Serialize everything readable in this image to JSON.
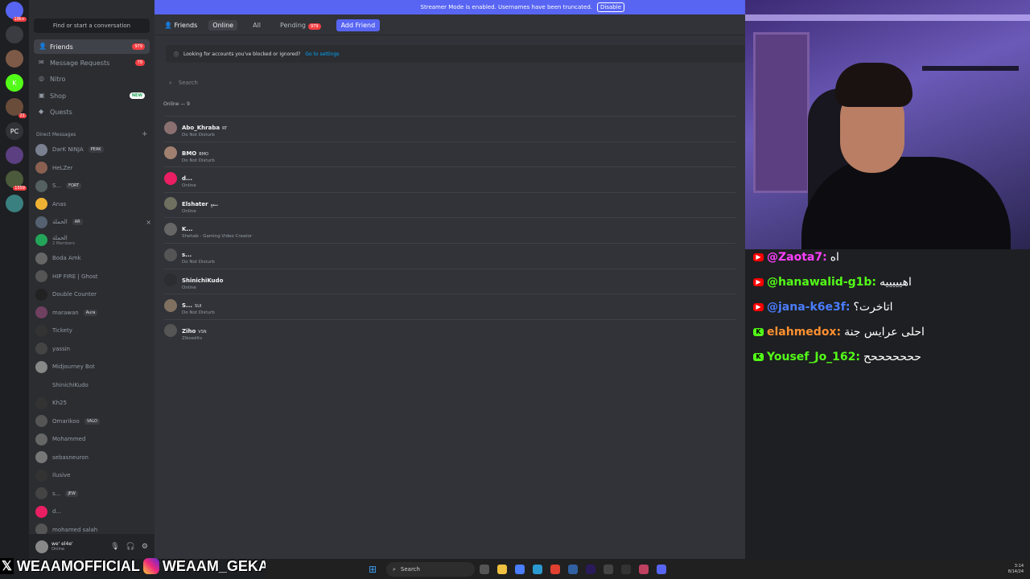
{
  "server_rail": [
    {
      "label": "",
      "badge": "18k+",
      "color": "#5865f2"
    },
    {
      "label": "",
      "badge": "",
      "color": "#3a3c42"
    },
    {
      "label": "",
      "badge": "",
      "color": "#7d5a47"
    },
    {
      "label": "K",
      "badge": "",
      "color": "#53fc18"
    },
    {
      "label": "",
      "badge": "21",
      "color": "#6a4c3b"
    },
    {
      "label": "PC",
      "badge": "",
      "color": "#313338"
    },
    {
      "label": "",
      "badge": "",
      "color": "#5b3f80"
    },
    {
      "label": "",
      "badge": "1559",
      "color": "#4a5a3a"
    },
    {
      "label": "",
      "badge": "",
      "color": "#3a8080"
    }
  ],
  "sidebar": {
    "search_placeholder": "Find or start a conversation",
    "nav": [
      {
        "label": "Friends",
        "count": "979",
        "icon": "friends-icon"
      },
      {
        "label": "Message Requests",
        "count": "79",
        "icon": "mail-icon"
      },
      {
        "label": "Nitro",
        "count": "",
        "icon": "nitro-icon"
      },
      {
        "label": "Shop",
        "count": "",
        "new": "NEW",
        "icon": "shop-icon"
      },
      {
        "label": "Quests",
        "count": "",
        "icon": "quests-icon"
      }
    ],
    "dm_header": "Direct Messages",
    "dms": [
      {
        "name": "DarK NINJA",
        "tag": "PEAK",
        "sub": "",
        "color": "#7a8090"
      },
      {
        "name": "HeLZer",
        "tag": "",
        "sub": "",
        "color": "#8a6050"
      },
      {
        "name": "S...",
        "tag": "FORT",
        "sub": "",
        "color": "#556060"
      },
      {
        "name": "Anas",
        "tag": "",
        "sub": "",
        "color": "#f0b232"
      },
      {
        "name": "الحملة",
        "tag": "AR",
        "sub": "",
        "color": "#556070"
      },
      {
        "name": "الحملة",
        "tag": "",
        "sub": "2 Members",
        "color": "#23a559"
      },
      {
        "name": "Boda Amk",
        "tag": "",
        "sub": "",
        "color": "#666"
      },
      {
        "name": "HIP FIRE | Ghost",
        "tag": "",
        "sub": "",
        "color": "#555"
      },
      {
        "name": "Double Counter",
        "tag": "",
        "sub": "",
        "color": "#222"
      },
      {
        "name": "marawan",
        "tag": "Aura",
        "sub": "",
        "color": "#704060"
      },
      {
        "name": "Tickety",
        "tag": "",
        "sub": "",
        "color": "#333"
      },
      {
        "name": "yassin",
        "tag": "",
        "sub": "",
        "color": "#444"
      },
      {
        "name": "Midjourney Bot",
        "tag": "",
        "sub": "",
        "color": "#888"
      },
      {
        "name": "ShinichiKudo",
        "tag": "",
        "sub": "",
        "color": "#2b2d31"
      },
      {
        "name": "Kh25",
        "tag": "",
        "sub": "",
        "color": "#333"
      },
      {
        "name": "Omarikoo",
        "tag": "VALO",
        "sub": "",
        "color": "#555"
      },
      {
        "name": "Mohammed",
        "tag": "",
        "sub": "",
        "color": "#666"
      },
      {
        "name": "sebasneuron",
        "tag": "",
        "sub": "",
        "color": "#777"
      },
      {
        "name": "Ilusive",
        "tag": "",
        "sub": "",
        "color": "#333"
      },
      {
        "name": "s...",
        "tag": "JEW",
        "sub": "",
        "color": "#444"
      },
      {
        "name": "d...",
        "tag": "",
        "sub": "",
        "color": "#e91e63"
      },
      {
        "name": "mohamed salah",
        "tag": "",
        "sub": "",
        "color": "#555"
      }
    ],
    "user": {
      "name": "we' el4e'",
      "status": "Online"
    }
  },
  "main": {
    "streamer_text": "Streamer Mode is enabled. Usernames have been truncated.",
    "streamer_button": "Disable",
    "tabs": {
      "title": "Friends",
      "online": "Online",
      "all": "All",
      "pending": "Pending",
      "pending_count": "979",
      "add": "Add Friend"
    },
    "notice_text": "Looking for accounts you've blocked or ignored?",
    "notice_link": "Go to settings",
    "search_placeholder": "Search",
    "online_header": "Online — 9",
    "friends": [
      {
        "name": "Abo_Khraba",
        "tag": "RT",
        "status": "Do Not Disturb",
        "color": "#8a7070"
      },
      {
        "name": "BMO",
        "tag": "BMO",
        "status": "Do Not Disturb",
        "color": "#a08070"
      },
      {
        "name": "d...",
        "tag": "",
        "status": "Online",
        "color": "#e91e63"
      },
      {
        "name": "Elshater",
        "tag": "سقع",
        "status": "Online",
        "color": "#707060"
      },
      {
        "name": "K...",
        "tag": "",
        "status": "Shehab - Gaming Video Creator",
        "color": "#666"
      },
      {
        "name": "s...",
        "tag": "",
        "status": "Do Not Disturb",
        "color": "#555"
      },
      {
        "name": "ShinichiKudo",
        "tag": "",
        "status": "Online",
        "color": "#2b2d31"
      },
      {
        "name": "S...",
        "tag": "SUI",
        "status": "Do Not Disturb",
        "color": "#807060"
      },
      {
        "name": "Ziho",
        "tag": "VSN",
        "status": "Zikoedits",
        "color": "#555"
      }
    ]
  },
  "chat": [
    {
      "platform": "yt",
      "user": "@Zaota7:",
      "text": "اه",
      "color": "#ff40ff"
    },
    {
      "platform": "yt",
      "user": "@hanawalid-g1b:",
      "text": "اهيييييه",
      "color": "#53fc18"
    },
    {
      "platform": "yt",
      "user": "@jana-k6e3f:",
      "text": "اتاخرت؟",
      "color": "#4a7dff"
    },
    {
      "platform": "kick",
      "user": "elahmedox:",
      "text": "احلى عرايس جنة",
      "color": "#ff9030"
    },
    {
      "platform": "kick",
      "user": "Yousef_Jo_162:",
      "text": "حححححححح",
      "color": "#53fc18"
    }
  ],
  "socials": {
    "x_handle": "WEAAMOFFICIAL",
    "ig_handle": "WEAAM_GEKA"
  },
  "taskbar": {
    "search": "Search",
    "time": "3:14",
    "date": "8/14/24"
  }
}
